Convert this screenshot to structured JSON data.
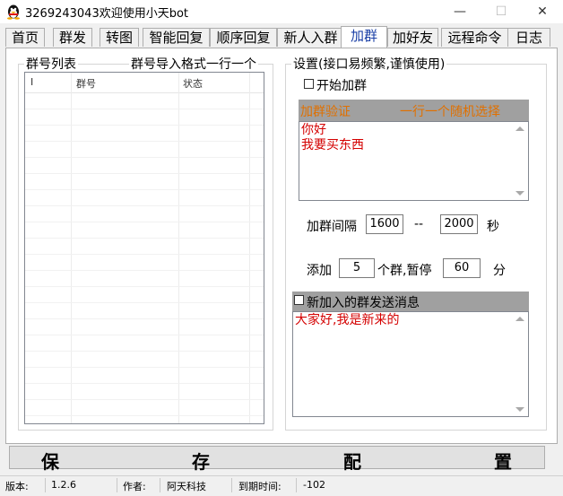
{
  "window": {
    "title": "3269243043欢迎使用小天bot",
    "controls": {
      "minimize": "—",
      "maximize": "☐",
      "close": "✕"
    }
  },
  "tabs": [
    {
      "label": "首页"
    },
    {
      "label": "群发"
    },
    {
      "label": "转图"
    },
    {
      "label": "智能回复"
    },
    {
      "label": "顺序回复"
    },
    {
      "label": "新人入群"
    },
    {
      "label": "加群",
      "active": true
    },
    {
      "label": "加好友"
    },
    {
      "label": "远程命令"
    },
    {
      "label": "日志"
    }
  ],
  "left_group": {
    "title": "群号列表",
    "hint": "群号导入格式一行一个",
    "columns": [
      "I",
      "群号",
      "状态"
    ]
  },
  "right_group": {
    "title": "设置(接口易频繁,谨慎使用)",
    "start_checkbox_label": "开始加群",
    "verify_header_left": "加群验证",
    "verify_header_right": "一行一个随机选择",
    "verify_lines": [
      "你好",
      "我要买东西"
    ],
    "interval_label": "加群间隔",
    "interval_min": "1600",
    "interval_sep": "--",
    "interval_max": "2000",
    "interval_unit": "秒",
    "add_label": "添加",
    "add_count": "5",
    "pause_label": "个群,暂停",
    "pause_minutes": "60",
    "pause_unit": "分",
    "welcome_checkbox_label": "新加入的群发送消息",
    "welcome_message": "大家好,我是新来的"
  },
  "save_button": {
    "chars": [
      "保",
      "存",
      "配",
      "置"
    ]
  },
  "statusbar": {
    "version_label": "版本:",
    "version": "1.2.6",
    "author_label": "作者:",
    "author": "阿天科技",
    "expire_label": "到期时间:",
    "expire_value": "-102"
  },
  "colors": {
    "accent_tab": "#1a3fa6",
    "verify_header_bg": "#a0a0a0",
    "verify_header_text": "#e07000",
    "message_text": "#d40000"
  }
}
